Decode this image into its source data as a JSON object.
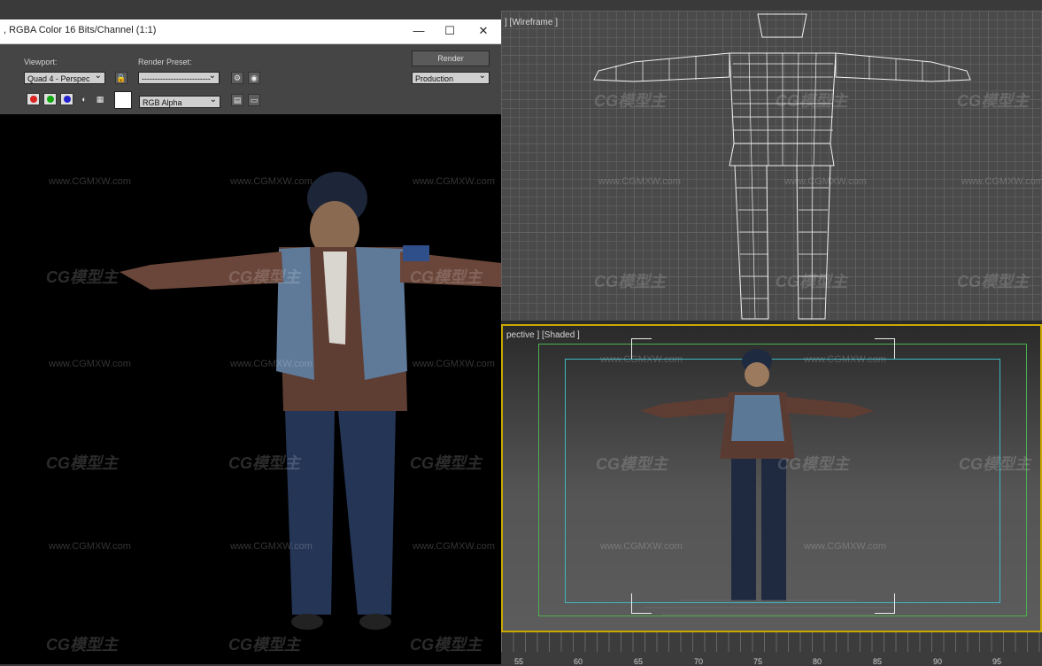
{
  "render_window": {
    "title": ", RGBA Color 16 Bits/Channel (1:1)",
    "viewport_label": "Viewport:",
    "viewport_value": "Quad 4 - Perspec",
    "render_preset_label": "Render Preset:",
    "render_preset_value": "--------------------------",
    "render_button": "Render",
    "production_value": "Production",
    "channel_value": "RGB Alpha",
    "minimize": "—",
    "maximize": "☐",
    "close": "✕"
  },
  "viewports": {
    "top_label": "] [Wireframe ]",
    "persp_label": "pective ] [Shaded ]"
  },
  "timeline": {
    "ticks": [
      "55",
      "60",
      "65",
      "70",
      "75",
      "80",
      "85",
      "90",
      "95"
    ]
  },
  "watermark": {
    "logo": "CG模型主",
    "url": "www.CGMXW.com"
  },
  "colors": {
    "accent_yellow": "#c9a800",
    "safe_frame_green": "#4caf50",
    "safe_frame_cyan": "#3fb8c4"
  }
}
